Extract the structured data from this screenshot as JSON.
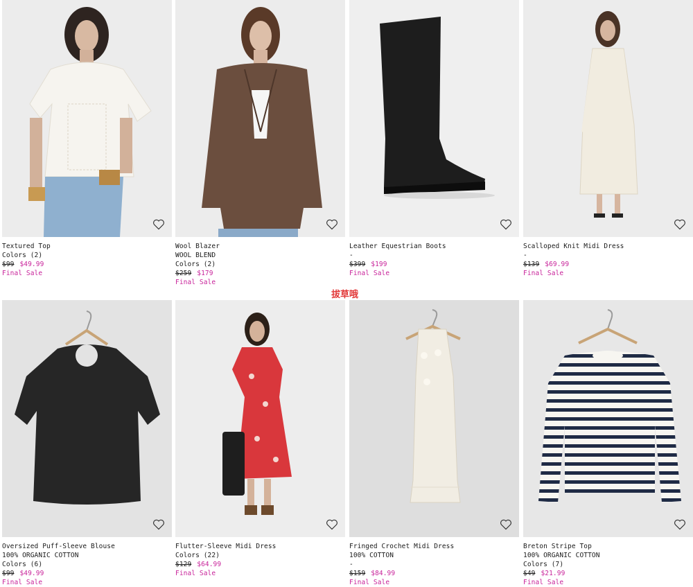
{
  "products": [
    {
      "name": "Textured Top",
      "line2": "Colors (2)",
      "line3": "",
      "was": "$99",
      "now": "$49.99",
      "sale": "Final Sale",
      "heart": "heart-icon"
    },
    {
      "name": "Wool Blazer",
      "line2": "WOOL BLEND",
      "line3": "Colors (2)",
      "was": "$259",
      "now": "$179",
      "sale": "Final Sale",
      "heart": "heart-icon"
    },
    {
      "name": "Leather Equestrian Boots",
      "line2": "-",
      "line3": "",
      "was": "$399",
      "now": "$199",
      "sale": "Final Sale",
      "heart": "heart-icon"
    },
    {
      "name": "Scalloped Knit Midi Dress",
      "line2": "-",
      "line3": "",
      "was": "$139",
      "now": "$69.99",
      "sale": "Final Sale",
      "heart": "heart-icon"
    },
    {
      "name": "Oversized Puff-Sleeve Blouse",
      "line2": "100% ORGANIC COTTON",
      "line3": "Colors (6)",
      "was": "$99",
      "now": "$49.99",
      "sale": "Final Sale",
      "heart": "heart-icon"
    },
    {
      "name": "Flutter-Sleeve Midi Dress",
      "line2": "Colors (22)",
      "line3": "",
      "was": "$129",
      "now": "$64.99",
      "sale": "Final Sale",
      "heart": "heart-icon"
    },
    {
      "name": "Fringed Crochet Midi Dress",
      "line2": "100% COTTON",
      "line3": "-",
      "was": "$159",
      "now": "$84.99",
      "sale": "Final Sale",
      "heart": "heart-icon"
    },
    {
      "name": "Breton Stripe Top",
      "line2": "100% ORGANIC COTTON",
      "line3": "Colors (7)",
      "was": "$49",
      "now": "$21.99",
      "sale": "Final Sale",
      "heart": "heart-icon"
    }
  ],
  "watermark": "拔草哦",
  "colors": {
    "sale": "#c8239a",
    "watermark": "#e23a3a",
    "image_bg": "#eeeeee"
  }
}
